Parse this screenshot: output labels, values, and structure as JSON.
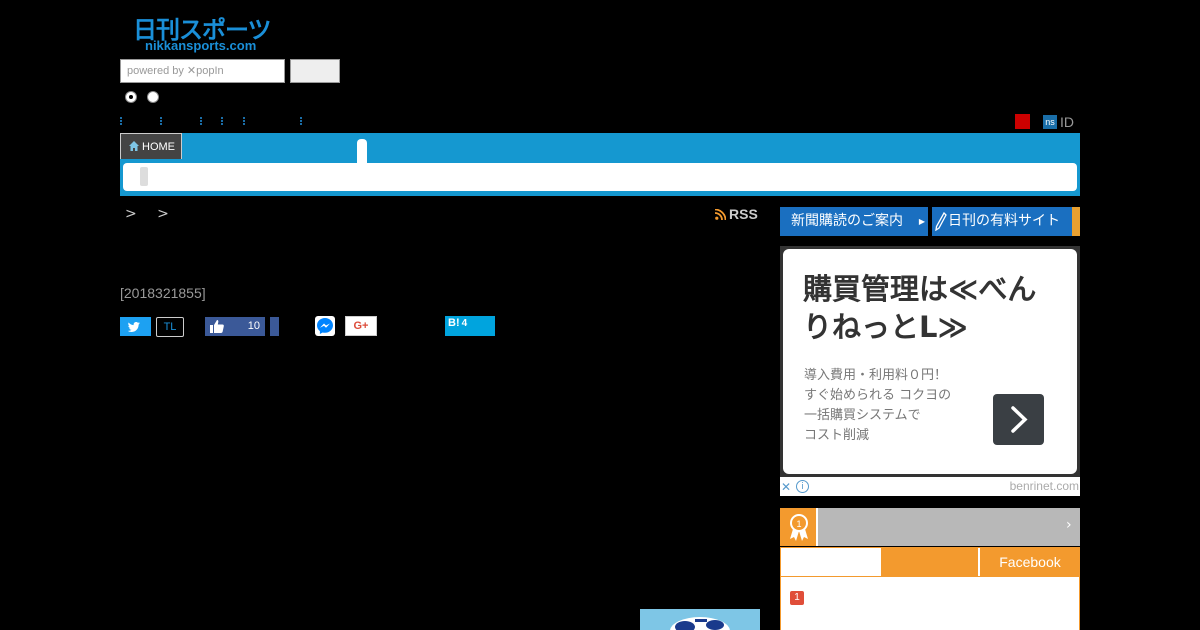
{
  "header": {
    "logo_text": "日刊スポーツ",
    "logo_domain": "nikkansports.com",
    "search": {
      "placeholder": "powered by ✕popIn"
    }
  },
  "account": {
    "ns_badge": "ns",
    "id_label": "ID"
  },
  "nav": {
    "home_label": "HOME"
  },
  "breadcrumb": {
    "text": "> >"
  },
  "rss_label": "RSS",
  "article": {
    "id_text": "[2018321855]"
  },
  "share": {
    "tl_label": "TL",
    "facebook_count": "10",
    "googleplus_label": "G+",
    "hatena_label": "B!",
    "hatena_count": "4"
  },
  "sidebar": {
    "subscription_label": "新聞購読のご案内",
    "paid_sites_label": "日刊の有料サイト",
    "ad": {
      "title": "購買管理は≪べんりねっとL≫",
      "desc_lines": [
        "導入費用・利用料０円！",
        "すぐ始められる コクヨの",
        "一括購買システムで",
        "コスト削減"
      ],
      "domain": "benrinet.com",
      "close": "✕",
      "info": "i"
    },
    "ranking": {
      "chevron": "›",
      "tab_facebook": "Facebook",
      "first_rank": "1"
    }
  },
  "colors": {
    "nav_blue": "#1598d0",
    "ranking_orange": "#f39a2e",
    "button_blue": "#1a6fc0"
  }
}
